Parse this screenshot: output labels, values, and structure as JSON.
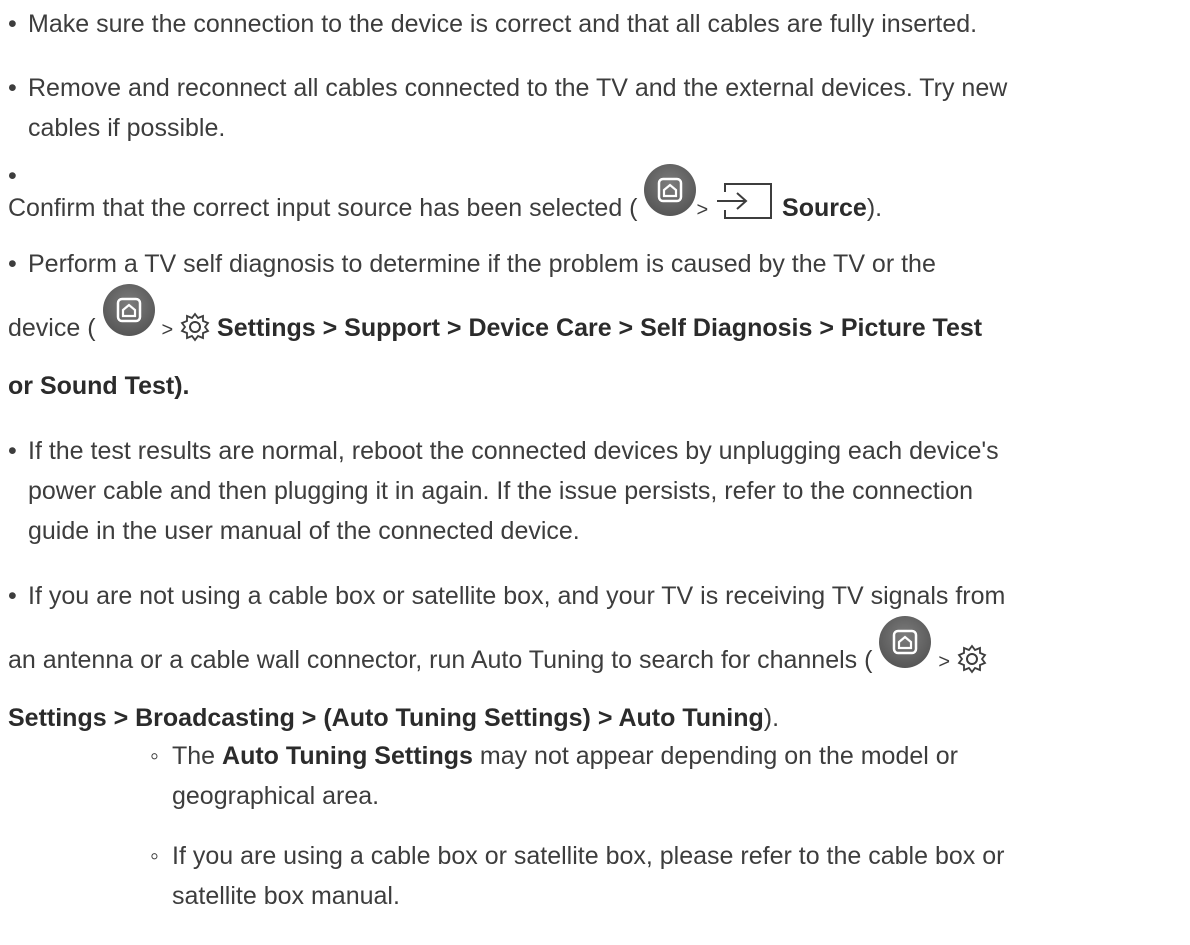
{
  "bullets": {
    "main": "•",
    "sub": "◦"
  },
  "items": [
    {
      "text": "Make sure the connection to the device is correct and that all cables are fully inserted."
    },
    {
      "line1": "Remove and reconnect all cables connected to the TV and the external devices. Try new",
      "line2": "cables if possible."
    },
    {
      "pre": "Confirm that the correct input source has been selected (",
      "gt": ">",
      "bold": "Source",
      "post": ")."
    },
    {
      "line1": "Perform a TV self diagnosis to determine if the problem is caused by the TV or the",
      "pre": "device (",
      "gt": ">",
      "bold1": "Settings > Support > Device Care > Self Diagnosis > Picture Test",
      "bold2": "or Sound Test)."
    },
    {
      "line1": "If the test results are normal, reboot the connected devices by unplugging each device's",
      "line2": "power cable and then plugging it in again. If the issue persists, refer to the connection",
      "line3": "guide in the user manual of the connected device."
    },
    {
      "line1": "If you are not using a cable box or satellite box, and your TV is receiving TV signals from",
      "pre": "an antenna or a cable wall connector, run Auto Tuning to search for channels (",
      "gt": ">",
      "bold": "Settings > Broadcasting > (Auto Tuning Settings) > Auto Tuning",
      "post": ")."
    }
  ],
  "subitems": [
    {
      "pre": "The ",
      "bold": "Auto Tuning Settings",
      "post": " may not appear depending on the model or",
      "line2": "geographical area."
    },
    {
      "line1": "If you are using a cable box or satellite box, please refer to the cable box or",
      "line2": "satellite box manual."
    }
  ],
  "icons": {
    "home": "home-icon",
    "source": "source-input-icon",
    "settings": "gear-icon"
  },
  "colors": {
    "text": "#3d3d3d",
    "icon_circle": "#5a5a5a"
  }
}
